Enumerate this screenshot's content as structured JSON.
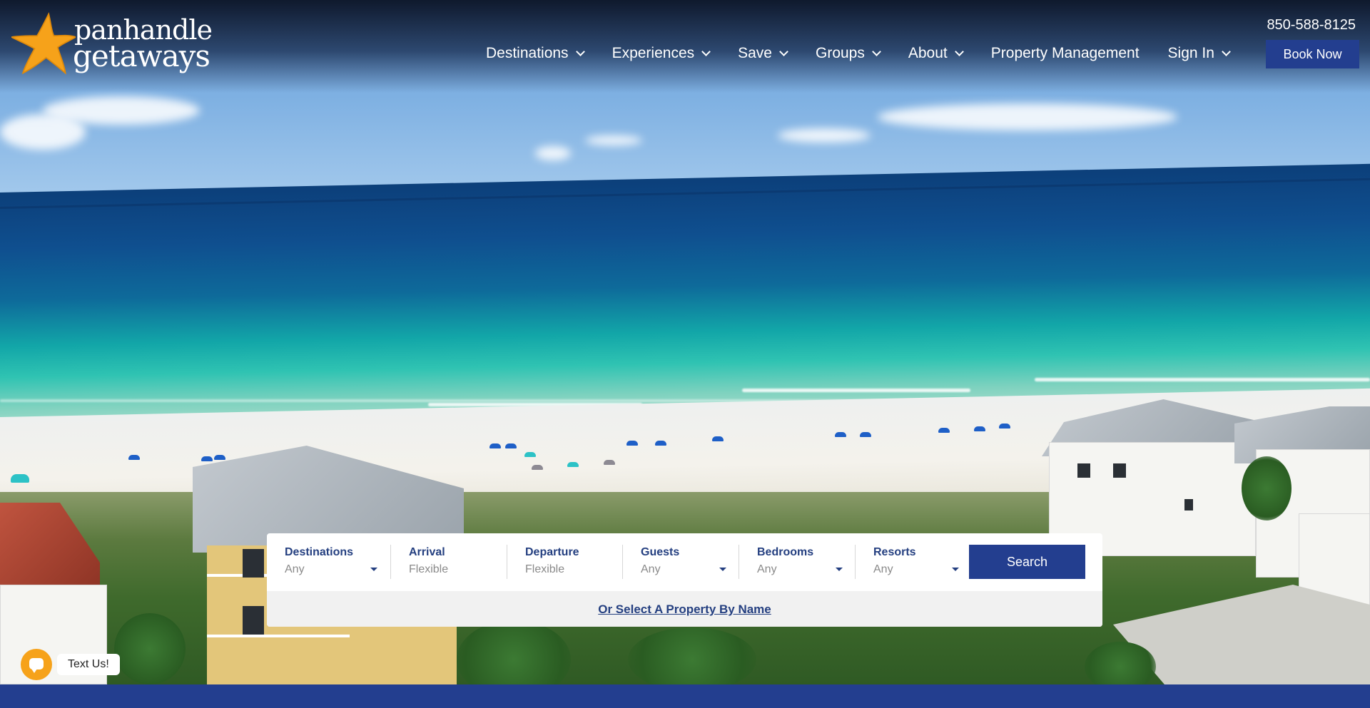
{
  "brand": {
    "logo_line1": "panhandle",
    "logo_line2": "getaways",
    "star_color": "#f6a21a"
  },
  "header": {
    "phone": "850-588-8125",
    "nav": [
      {
        "label": "Destinations",
        "has_dropdown": true
      },
      {
        "label": "Experiences",
        "has_dropdown": true
      },
      {
        "label": "Save",
        "has_dropdown": true
      },
      {
        "label": "Groups",
        "has_dropdown": true
      },
      {
        "label": "About",
        "has_dropdown": true
      },
      {
        "label": "Property Management",
        "has_dropdown": false
      },
      {
        "label": "Sign In",
        "has_dropdown": true
      }
    ],
    "book_now": "Book Now"
  },
  "search": {
    "fields": [
      {
        "label": "Destinations",
        "value": "Any",
        "dropdown": true
      },
      {
        "label": "Arrival",
        "value": "Flexible",
        "dropdown": false
      },
      {
        "label": "Departure",
        "value": "Flexible",
        "dropdown": false
      },
      {
        "label": "Guests",
        "value": "Any",
        "dropdown": true
      },
      {
        "label": "Bedrooms",
        "value": "Any",
        "dropdown": true
      },
      {
        "label": "Resorts",
        "value": "Any",
        "dropdown": true
      }
    ],
    "button": "Search",
    "by_name_link": "Or Select A Property By Name"
  },
  "chat_widget": {
    "label": "Text Us!",
    "icon": "chat-bubble-icon"
  },
  "colors": {
    "primary": "#233e8f",
    "accent": "#f6a21a"
  }
}
